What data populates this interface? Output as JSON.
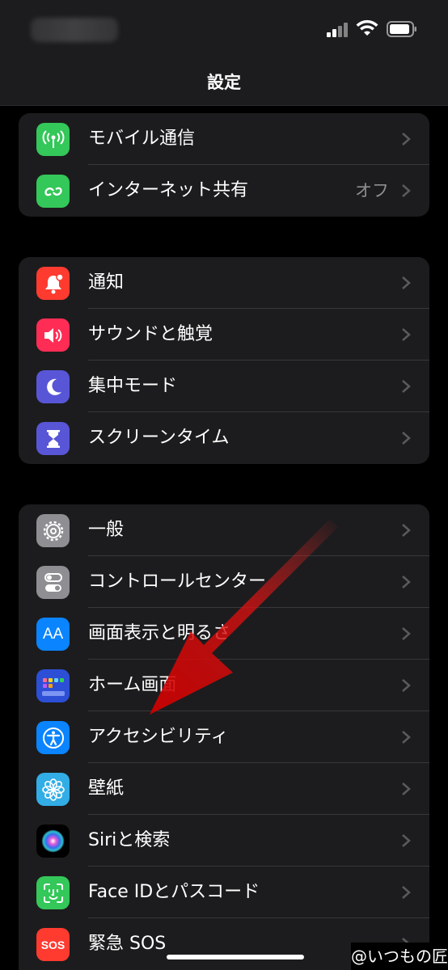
{
  "nav": {
    "title": "設定"
  },
  "group1": [
    {
      "label": "モバイル通信",
      "icon": "antenna-icon",
      "color": "#34c759"
    },
    {
      "label": "インターネット共有",
      "detail": "オフ",
      "icon": "link-icon",
      "color": "#34c759"
    }
  ],
  "group2": [
    {
      "label": "通知",
      "icon": "bell-icon",
      "color": "#ff3b30"
    },
    {
      "label": "サウンドと触覚",
      "icon": "speaker-icon",
      "color": "#ff2d55"
    },
    {
      "label": "集中モード",
      "icon": "moon-icon",
      "color": "#5856d6"
    },
    {
      "label": "スクリーンタイム",
      "icon": "hourglass-icon",
      "color": "#5856d6"
    }
  ],
  "group3": [
    {
      "label": "一般",
      "icon": "gear-icon",
      "color": "#8e8e93"
    },
    {
      "label": "コントロールセンター",
      "icon": "toggles-icon",
      "color": "#8e8e93"
    },
    {
      "label": "画面表示と明るさ",
      "icon": "text-size-icon",
      "color": "#0a84ff",
      "glyph": "AA"
    },
    {
      "label": "ホーム画面",
      "icon": "home-screen-icon",
      "color": "#2c4fd6"
    },
    {
      "label": "アクセシビリティ",
      "icon": "accessibility-icon",
      "color": "#0a84ff"
    },
    {
      "label": "壁紙",
      "icon": "flower-icon",
      "color": "#32ade6"
    },
    {
      "label": "Siriと検索",
      "icon": "siri-icon",
      "color": "#1c1c1e"
    },
    {
      "label": "Face IDとパスコード",
      "icon": "face-id-icon",
      "color": "#34c759"
    },
    {
      "label": "緊急 SOS",
      "icon": "sos-icon",
      "color": "#ff3b30",
      "glyph": "SOS"
    }
  ],
  "watermark": "@いつもの匠"
}
